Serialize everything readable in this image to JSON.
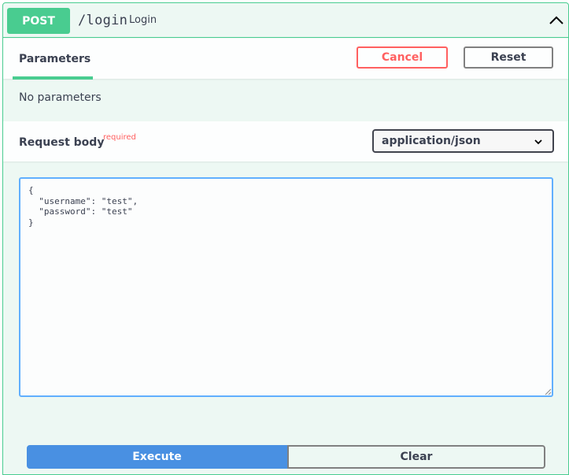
{
  "operation": {
    "method": "POST",
    "path": "/login",
    "summary": "Login",
    "colors": {
      "method": "#49cc90",
      "background": "#edf8f3",
      "border": "#49cc90"
    },
    "collapse_icon": "chevron-up-icon"
  },
  "parameters": {
    "tab_label": "Parameters",
    "cancel_label": "Cancel",
    "reset_label": "Reset",
    "empty_text": "No parameters"
  },
  "request_body": {
    "label": "Request body",
    "required_label": "required",
    "content_type": "application/json",
    "content_type_icon": "chevron-down-icon",
    "value": "{\n  \"username\": \"test\",\n  \"password\": \"test\"\n}"
  },
  "actions": {
    "execute_label": "Execute",
    "clear_label": "Clear",
    "colors": {
      "execute": "#4990e2",
      "cancel": "#ff6060"
    }
  }
}
